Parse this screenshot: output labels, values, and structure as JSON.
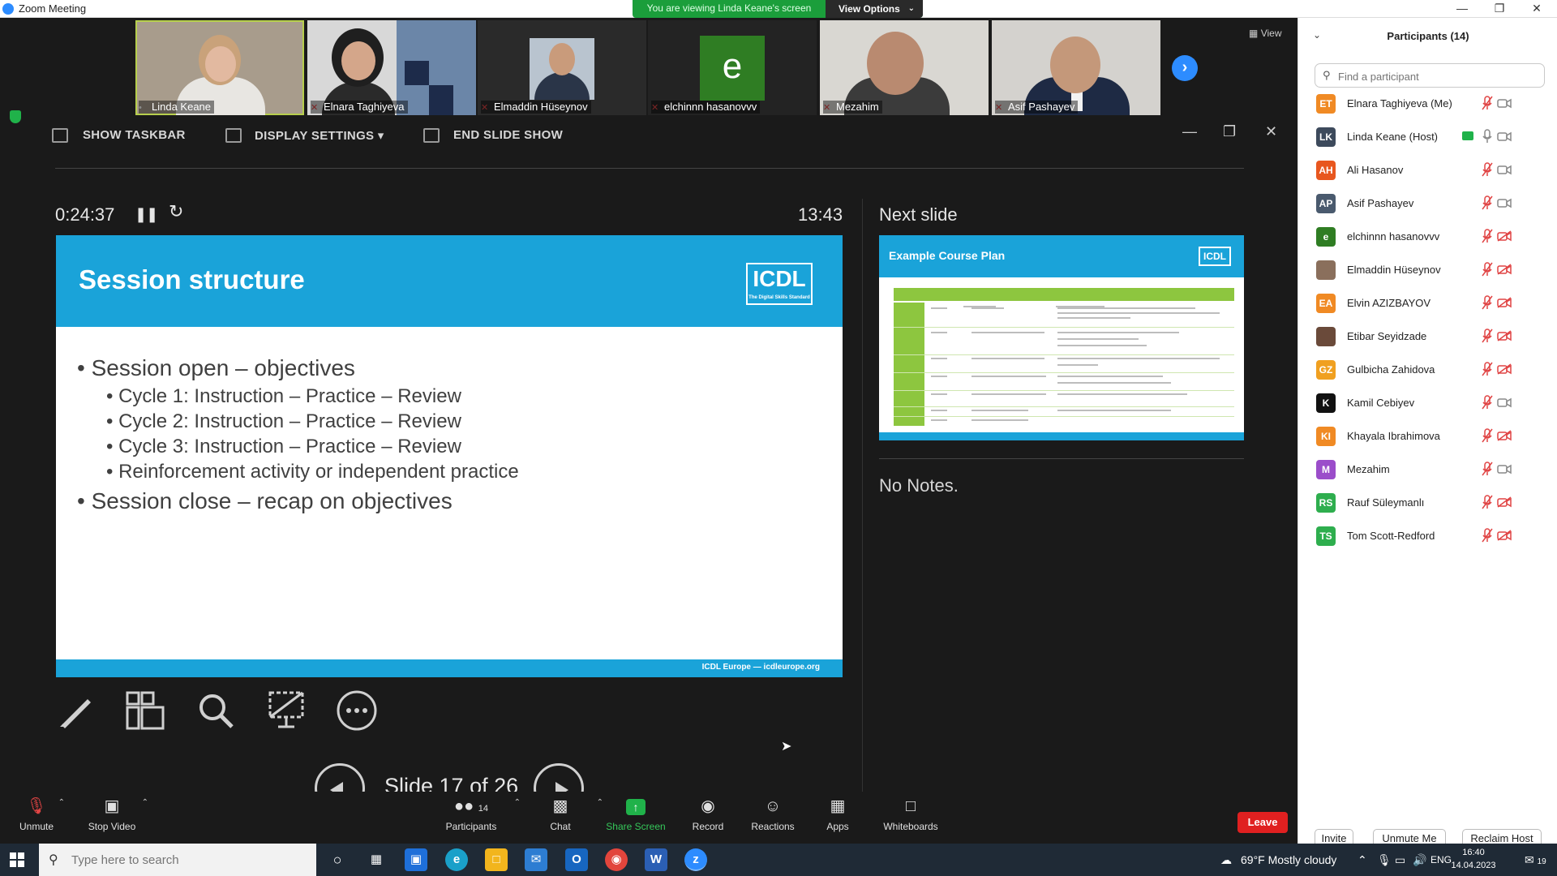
{
  "window": {
    "title": "Zoom Meeting",
    "viewing_banner": "You are viewing Linda Keane's screen",
    "view_options": "View Options",
    "view_label": "View"
  },
  "thumbnails": [
    {
      "name": "Linda Keane",
      "muted": false,
      "active": true
    },
    {
      "name": "Elnara Taghiyeva",
      "muted": true,
      "active": false
    },
    {
      "name": "Elmaddin Hüseynov",
      "muted": true,
      "active": false
    },
    {
      "name": "elchinnn hasanovvv",
      "muted": true,
      "active": false,
      "avatar_letter": "e"
    },
    {
      "name": "Mezahim",
      "muted": true,
      "active": false
    },
    {
      "name": "Asif Pashayev",
      "muted": true,
      "active": false
    }
  ],
  "presenter": {
    "toolbar": {
      "show_taskbar": "SHOW TASKBAR",
      "display_settings": "DISPLAY SETTINGS ▾",
      "end_slide_show": "END SLIDE SHOW"
    },
    "timer": "0:24:37",
    "clock": "13:43",
    "next_slide_label": "Next slide",
    "notes": "No Notes.",
    "slide_counter": "Slide 17 of 26"
  },
  "current_slide": {
    "title": "Session structure",
    "logo": "ICDL",
    "logo_tagline": "The Digital Skills Standard",
    "bullets": [
      {
        "level": 1,
        "text": "• Session open – objectives"
      },
      {
        "level": 2,
        "text": "• Cycle 1: Instruction – Practice – Review"
      },
      {
        "level": 2,
        "text": "• Cycle 2: Instruction – Practice – Review"
      },
      {
        "level": 2,
        "text": "• Cycle 3: Instruction – Practice – Review"
      },
      {
        "level": 2,
        "text": "• Reinforcement activity or independent practice"
      },
      {
        "level": 1,
        "text": "• Session close – recap on objectives"
      }
    ],
    "footer": "ICDL Europe — icdleurope.org"
  },
  "next_slide": {
    "title": "Example Course Plan",
    "logo": "ICDL"
  },
  "zoom_toolbar": {
    "unmute": "Unmute",
    "stop_video": "Stop Video",
    "participants": "Participants",
    "participants_count": "14",
    "chat": "Chat",
    "share_screen": "Share Screen",
    "record": "Record",
    "reactions": "Reactions",
    "apps": "Apps",
    "whiteboards": "Whiteboards",
    "leave": "Leave"
  },
  "participants_panel": {
    "title": "Participants (14)",
    "search_placeholder": "Find a participant",
    "participants": [
      {
        "initials": "ET",
        "name": "Elnara Taghiyeva (Me)",
        "color": "#f08a24",
        "mic": "muted",
        "cam": "on"
      },
      {
        "initials": "LK",
        "name": "Linda Keane (Host)",
        "color": "#3d4a5c",
        "mic": "on",
        "cam": "on",
        "sharing": true
      },
      {
        "initials": "AH",
        "name": "Ali Hasanov",
        "color": "#e8571f",
        "mic": "muted",
        "cam": "on"
      },
      {
        "initials": "AP",
        "name": "Asif Pashayev",
        "color": "#4a5a6e",
        "mic": "muted",
        "cam": "on"
      },
      {
        "initials": "e",
        "name": "elchinnn hasanovvv",
        "color": "#2f7d23",
        "mic": "muted",
        "cam": "off"
      },
      {
        "initials": "",
        "name": "Elmaddin Hüseynov",
        "color": "#8a6f5c",
        "mic": "muted",
        "cam": "off"
      },
      {
        "initials": "EA",
        "name": "Elvin AZIZBAYOV",
        "color": "#f08a24",
        "mic": "muted",
        "cam": "off"
      },
      {
        "initials": "",
        "name": "Etibar Seyidzade",
        "color": "#6a4a3a",
        "mic": "muted",
        "cam": "off"
      },
      {
        "initials": "GZ",
        "name": "Gulbicha Zahidova",
        "color": "#f0a020",
        "mic": "muted",
        "cam": "off"
      },
      {
        "initials": "K",
        "name": "Kamil Cebiyev",
        "color": "#111111",
        "mic": "muted",
        "cam": "on"
      },
      {
        "initials": "KI",
        "name": "Khayala Ibrahimova",
        "color": "#f08a24",
        "mic": "muted",
        "cam": "off"
      },
      {
        "initials": "M",
        "name": "Mezahim",
        "color": "#9b4dca",
        "mic": "muted",
        "cam": "on"
      },
      {
        "initials": "RS",
        "name": "Rauf Süleymanlı",
        "color": "#2eae4e",
        "mic": "muted",
        "cam": "off"
      },
      {
        "initials": "TS",
        "name": "Tom Scott-Redford",
        "color": "#2eae4e",
        "mic": "muted",
        "cam": "off"
      }
    ],
    "buttons": {
      "invite": "Invite",
      "unmute_me": "Unmute Me",
      "reclaim_host": "Reclaim Host"
    }
  },
  "taskbar": {
    "search_placeholder": "Type here to search",
    "weather": "69°F  Mostly cloudy",
    "language": "ENG",
    "time": "16:40",
    "date": "14.04.2023",
    "notifications": "19"
  }
}
